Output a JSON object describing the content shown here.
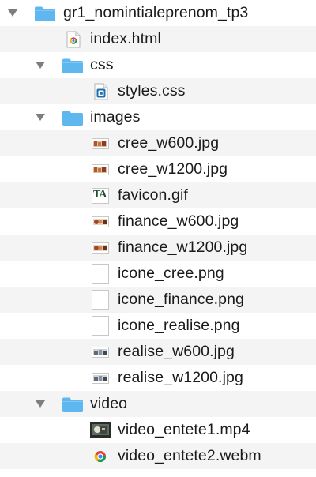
{
  "tree": {
    "root": {
      "label": "gr1_nomintialeprenom_tp3",
      "icon": "folder-icon"
    },
    "items": [
      {
        "id": "index",
        "label": "index.html",
        "icon": "chrome-html-icon"
      },
      {
        "id": "css",
        "label": "css",
        "icon": "folder-icon"
      },
      {
        "id": "styles",
        "label": "styles.css",
        "icon": "css-file-icon"
      },
      {
        "id": "images",
        "label": "images",
        "icon": "folder-icon"
      },
      {
        "id": "cree600",
        "label": "cree_w600.jpg",
        "icon": "jpg-thumbnail-icon"
      },
      {
        "id": "cree1200",
        "label": "cree_w1200.jpg",
        "icon": "jpg-thumbnail-icon"
      },
      {
        "id": "favicon",
        "label": "favicon.gif",
        "icon": "gif-thumbnail-icon"
      },
      {
        "id": "finance600",
        "label": "finance_w600.jpg",
        "icon": "jpg-thumbnail-icon"
      },
      {
        "id": "finance1200",
        "label": "finance_w1200.jpg",
        "icon": "jpg-thumbnail-icon"
      },
      {
        "id": "iconecree",
        "label": "icone_cree.png",
        "icon": "png-blank-icon"
      },
      {
        "id": "iconefinance",
        "label": "icone_finance.png",
        "icon": "png-blank-icon"
      },
      {
        "id": "iconerealise",
        "label": "icone_realise.png",
        "icon": "png-blank-icon"
      },
      {
        "id": "realise600",
        "label": "realise_w600.jpg",
        "icon": "jpg-thumbnail-icon"
      },
      {
        "id": "realise1200",
        "label": "realise_w1200.jpg",
        "icon": "jpg-thumbnail-icon"
      },
      {
        "id": "video",
        "label": "video",
        "icon": "folder-icon"
      },
      {
        "id": "entete1",
        "label": "video_entete1.mp4",
        "icon": "mp4-thumbnail-icon"
      },
      {
        "id": "entete2",
        "label": "video_entete2.webm",
        "icon": "chrome-webm-icon"
      }
    ]
  },
  "favicon_glyph": "TA",
  "colors": {
    "folder": "#5eb7ee",
    "stripe": "#f4f4f4",
    "disclosure": "#7e7e7e"
  }
}
